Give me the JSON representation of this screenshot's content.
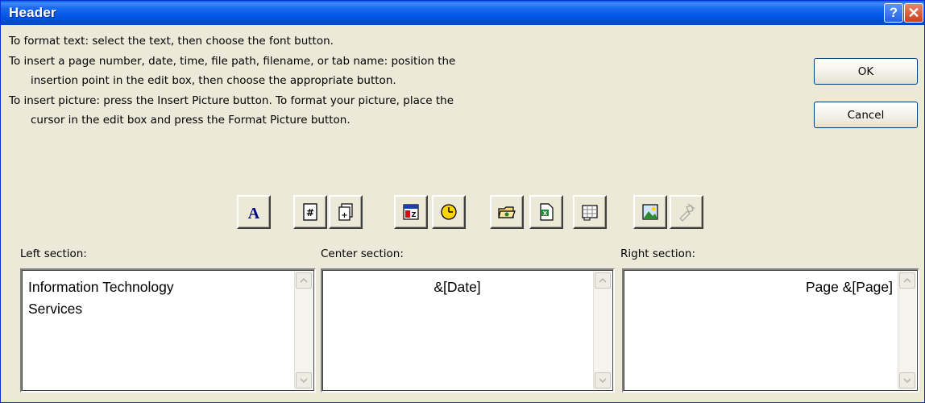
{
  "window": {
    "title": "Header",
    "help_glyph": "?",
    "close_glyph": "✕"
  },
  "instructions": {
    "lines": [
      "To format text:  select the text, then choose the font button.",
      "To insert a page number, date, time, file path, filename, or tab name:  position the",
      "insertion point in the edit box, then choose the appropriate button.",
      "To insert picture: press the Insert Picture button.  To format your picture, place the",
      "cursor in the edit box and press the Format Picture button."
    ]
  },
  "buttons": {
    "ok": "OK",
    "cancel": "Cancel"
  },
  "toolbar": {
    "items": [
      {
        "icon": "format-text-icon",
        "enabled": true
      },
      {
        "icon": "insert-page-number-icon",
        "enabled": true
      },
      {
        "icon": "insert-number-of-pages-icon",
        "enabled": true
      },
      {
        "icon": "insert-date-icon",
        "enabled": true
      },
      {
        "icon": "insert-time-icon",
        "enabled": true
      },
      {
        "icon": "insert-file-path-icon",
        "enabled": true
      },
      {
        "icon": "insert-file-name-icon",
        "enabled": true
      },
      {
        "icon": "insert-sheet-name-icon",
        "enabled": true
      },
      {
        "icon": "insert-picture-icon",
        "enabled": true
      },
      {
        "icon": "format-picture-icon",
        "enabled": false
      }
    ]
  },
  "sections": {
    "left": {
      "label": "Left section:",
      "lines": [
        "Information Technology",
        "Services"
      ]
    },
    "center": {
      "label": "Center section:",
      "lines": [
        "&[Date]"
      ]
    },
    "right": {
      "label": "Right section:",
      "lines": [
        "Page &[Page]"
      ]
    }
  },
  "colors": {
    "titlebar": "#0054e3",
    "dialog_bg": "#ece9d8",
    "close_button": "#c8411d"
  }
}
